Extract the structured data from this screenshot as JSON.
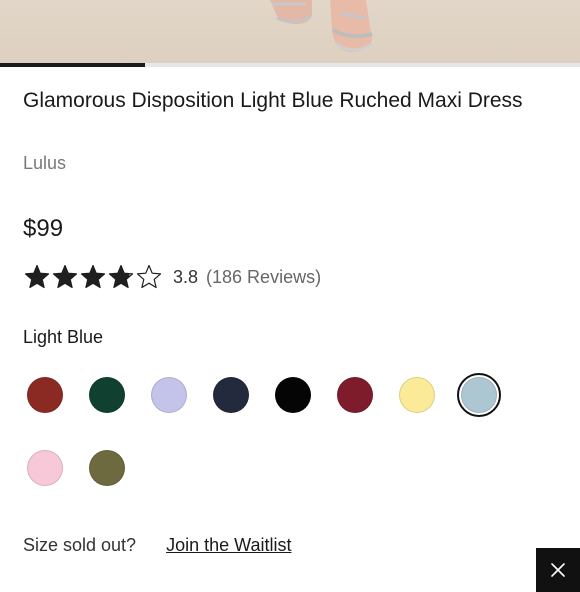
{
  "hero": {
    "alt_desc": ""
  },
  "carousel": {
    "progress": 0.25
  },
  "product": {
    "title": "Glamorous Disposition Light Blue Ruched Maxi Dress",
    "brand": "Lulus",
    "price": "$99",
    "rating": {
      "value": "3.8",
      "count_text": "(186 Reviews)",
      "stars_filled": 3.8,
      "stars_total": 5
    }
  },
  "color": {
    "selected_label": "Light Blue",
    "swatches": [
      {
        "name": "rust",
        "hex": "#8b2a22"
      },
      {
        "name": "dark-green",
        "hex": "#0f4030"
      },
      {
        "name": "lavender",
        "hex": "#c4c4ea"
      },
      {
        "name": "navy",
        "hex": "#232a3e"
      },
      {
        "name": "black",
        "hex": "#050505"
      },
      {
        "name": "burgundy",
        "hex": "#7e1c2b"
      },
      {
        "name": "yellow",
        "hex": "#fbeb98"
      },
      {
        "name": "light-blue",
        "hex": "#adc7d2",
        "selected": true
      },
      {
        "name": "pink",
        "hex": "#f6c8d8"
      },
      {
        "name": "olive",
        "hex": "#6c6a3e"
      }
    ]
  },
  "waitlist": {
    "prompt": "Size sold out?",
    "link": "Join the Waitlist"
  },
  "close": {
    "icon": "close-icon"
  },
  "colors": {
    "accent": "#111111",
    "star": "#1f1f1f"
  }
}
